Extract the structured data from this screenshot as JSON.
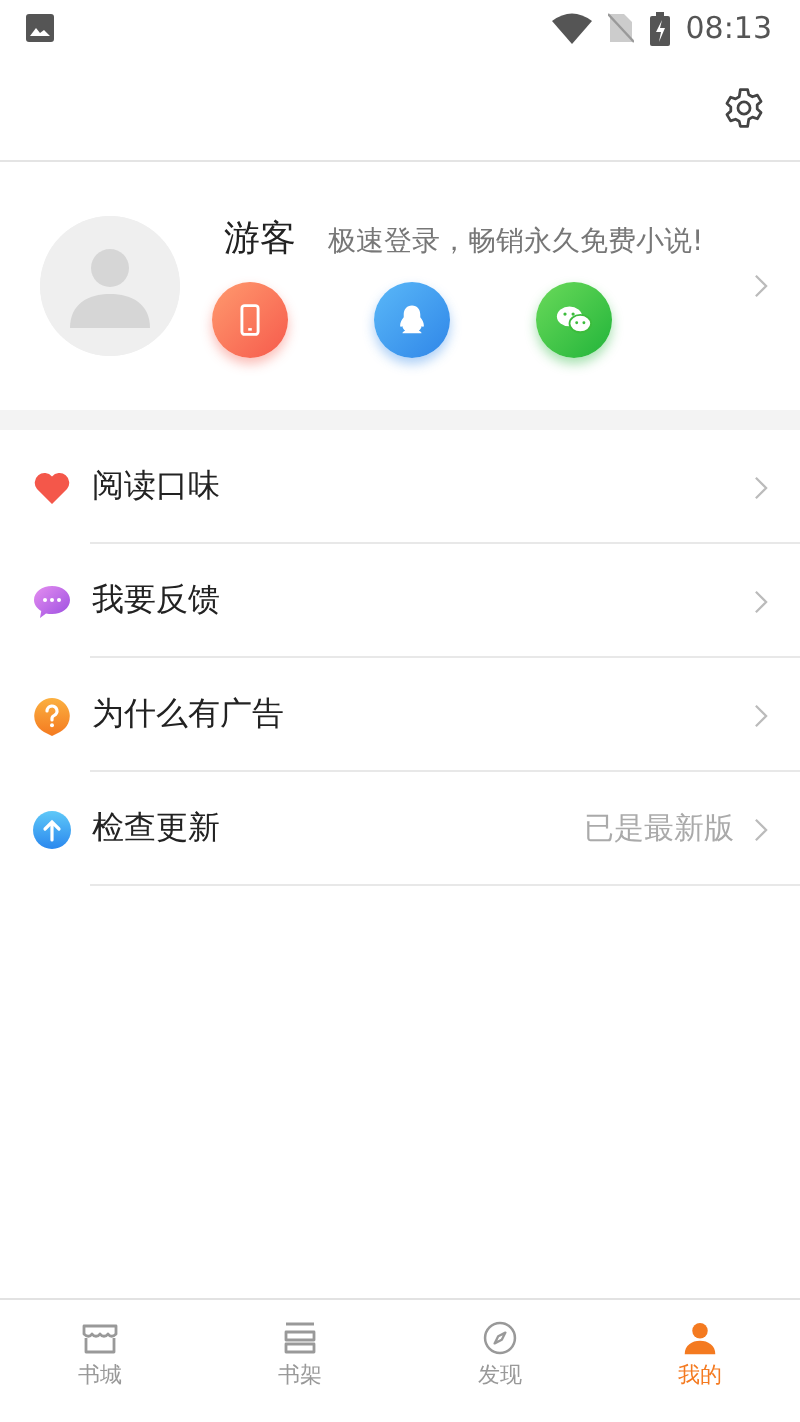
{
  "status_bar": {
    "time": "08:13"
  },
  "profile": {
    "name": "游客",
    "prompt": "极速登录，畅销永久免费小说!",
    "login_options": [
      {
        "kind": "phone"
      },
      {
        "kind": "qq"
      },
      {
        "kind": "wechat"
      }
    ]
  },
  "menu": [
    {
      "kind": "heart",
      "label": "阅读口味"
    },
    {
      "kind": "feedback",
      "label": "我要反馈"
    },
    {
      "kind": "question",
      "label": "为什么有广告"
    },
    {
      "kind": "update",
      "label": "检查更新",
      "value": "已是最新版"
    }
  ],
  "bottom_nav": [
    {
      "kind": "store",
      "label": "书城",
      "selected": false
    },
    {
      "kind": "shelf",
      "label": "书架",
      "selected": false
    },
    {
      "kind": "discover",
      "label": "发现",
      "selected": false
    },
    {
      "kind": "me",
      "label": "我的",
      "selected": true
    }
  ]
}
